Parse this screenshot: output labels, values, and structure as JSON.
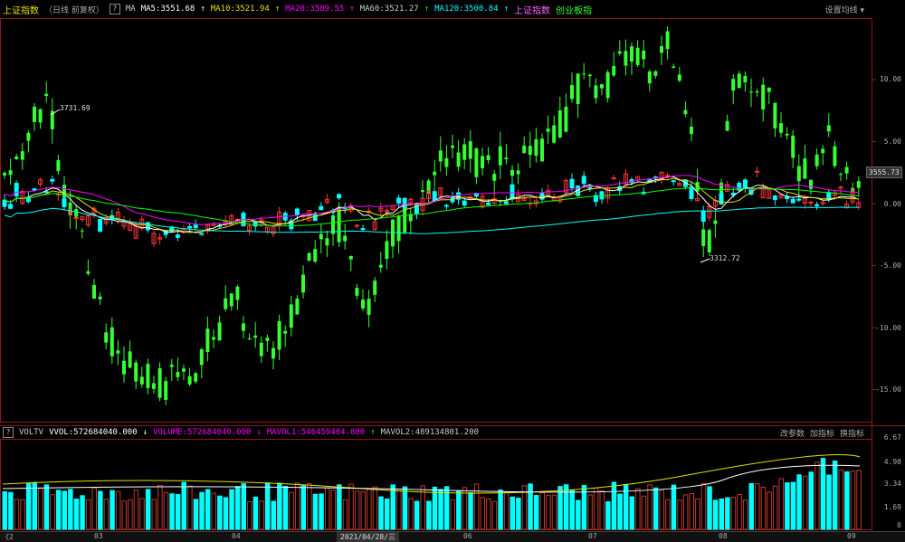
{
  "header": {
    "index_name": "上证指数",
    "index_sub": "（日线 前复权）",
    "help": "?",
    "ma_label": "MA",
    "ma5": "MA5:3551.68",
    "ma10": "MA10:3521.94",
    "ma20": "MA20:3509.55",
    "ma60": "MA60:3521.27",
    "ma120": "MA120:3500.84",
    "overlay": "上证指数",
    "startup": "创业板指",
    "settings": "设置均线 ▾"
  },
  "colors": {
    "ma5": "#ffffff",
    "ma10": "#e0e000",
    "ma20": "#ff00ff",
    "ma60": "#00ff00",
    "ma120": "#00ffff",
    "up": "#ff3333",
    "down": "#00ffff",
    "green": "#33ff33",
    "overlay": "#ff66ff",
    "startup": "#33ff33"
  },
  "annotations": {
    "high": "3731.69",
    "low": "3312.72",
    "price_tag": "3555.73"
  },
  "y_axis": [
    "10.00",
    "5.00",
    "0.00",
    "-5.00",
    "-10.00",
    "-15.00"
  ],
  "volume": {
    "label": "VOLTV",
    "vvol": "VVOL:572684040.000",
    "volume": "VOLUME:572684040.000",
    "mavol1": "MAVOL1:546459404.800",
    "mavol2": "MAVOL2:489134801.200",
    "buttons": [
      "改参数",
      "加指标",
      "换指标"
    ],
    "y_axis": [
      "6.67",
      "4.98",
      "3.34",
      "1.69",
      "0"
    ]
  },
  "x_axis": {
    "nav": "《2",
    "ticks": [
      "03",
      "04",
      "06",
      "07",
      "08",
      "09"
    ],
    "selected_date": "2021/04/28/三"
  },
  "chart_data": {
    "type": "candlestick",
    "y_axis_unit": "percent",
    "y_ticks": [
      10,
      5,
      0,
      -5,
      -10,
      -15
    ],
    "annotations": [
      {
        "label": "3731.69"
      },
      {
        "label": "3312.72"
      }
    ]
  }
}
